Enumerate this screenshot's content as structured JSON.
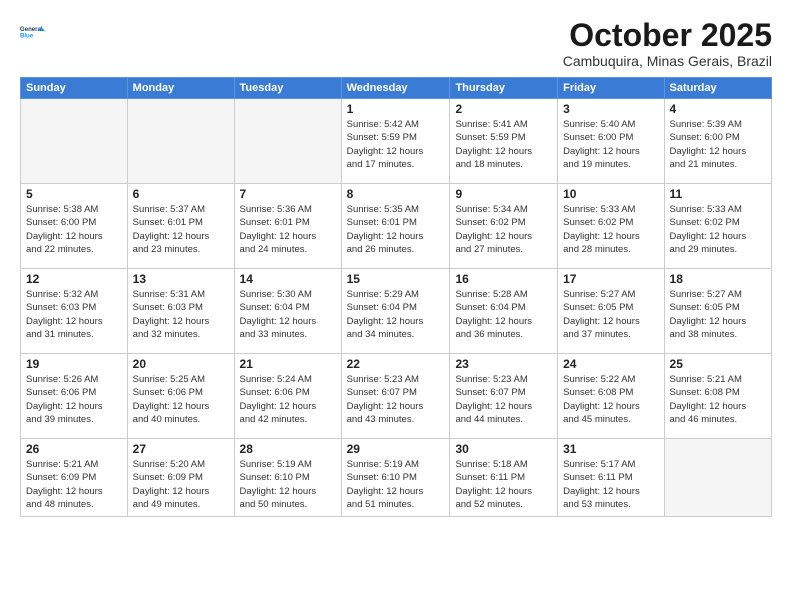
{
  "logo": {
    "line1": "General",
    "line2": "Blue"
  },
  "title": "October 2025",
  "location": "Cambuquira, Minas Gerais, Brazil",
  "days_header": [
    "Sunday",
    "Monday",
    "Tuesday",
    "Wednesday",
    "Thursday",
    "Friday",
    "Saturday"
  ],
  "weeks": [
    [
      {
        "day": "",
        "info": ""
      },
      {
        "day": "",
        "info": ""
      },
      {
        "day": "",
        "info": ""
      },
      {
        "day": "1",
        "info": "Sunrise: 5:42 AM\nSunset: 5:59 PM\nDaylight: 12 hours\nand 17 minutes."
      },
      {
        "day": "2",
        "info": "Sunrise: 5:41 AM\nSunset: 5:59 PM\nDaylight: 12 hours\nand 18 minutes."
      },
      {
        "day": "3",
        "info": "Sunrise: 5:40 AM\nSunset: 6:00 PM\nDaylight: 12 hours\nand 19 minutes."
      },
      {
        "day": "4",
        "info": "Sunrise: 5:39 AM\nSunset: 6:00 PM\nDaylight: 12 hours\nand 21 minutes."
      }
    ],
    [
      {
        "day": "5",
        "info": "Sunrise: 5:38 AM\nSunset: 6:00 PM\nDaylight: 12 hours\nand 22 minutes."
      },
      {
        "day": "6",
        "info": "Sunrise: 5:37 AM\nSunset: 6:01 PM\nDaylight: 12 hours\nand 23 minutes."
      },
      {
        "day": "7",
        "info": "Sunrise: 5:36 AM\nSunset: 6:01 PM\nDaylight: 12 hours\nand 24 minutes."
      },
      {
        "day": "8",
        "info": "Sunrise: 5:35 AM\nSunset: 6:01 PM\nDaylight: 12 hours\nand 26 minutes."
      },
      {
        "day": "9",
        "info": "Sunrise: 5:34 AM\nSunset: 6:02 PM\nDaylight: 12 hours\nand 27 minutes."
      },
      {
        "day": "10",
        "info": "Sunrise: 5:33 AM\nSunset: 6:02 PM\nDaylight: 12 hours\nand 28 minutes."
      },
      {
        "day": "11",
        "info": "Sunrise: 5:33 AM\nSunset: 6:02 PM\nDaylight: 12 hours\nand 29 minutes."
      }
    ],
    [
      {
        "day": "12",
        "info": "Sunrise: 5:32 AM\nSunset: 6:03 PM\nDaylight: 12 hours\nand 31 minutes."
      },
      {
        "day": "13",
        "info": "Sunrise: 5:31 AM\nSunset: 6:03 PM\nDaylight: 12 hours\nand 32 minutes."
      },
      {
        "day": "14",
        "info": "Sunrise: 5:30 AM\nSunset: 6:04 PM\nDaylight: 12 hours\nand 33 minutes."
      },
      {
        "day": "15",
        "info": "Sunrise: 5:29 AM\nSunset: 6:04 PM\nDaylight: 12 hours\nand 34 minutes."
      },
      {
        "day": "16",
        "info": "Sunrise: 5:28 AM\nSunset: 6:04 PM\nDaylight: 12 hours\nand 36 minutes."
      },
      {
        "day": "17",
        "info": "Sunrise: 5:27 AM\nSunset: 6:05 PM\nDaylight: 12 hours\nand 37 minutes."
      },
      {
        "day": "18",
        "info": "Sunrise: 5:27 AM\nSunset: 6:05 PM\nDaylight: 12 hours\nand 38 minutes."
      }
    ],
    [
      {
        "day": "19",
        "info": "Sunrise: 5:26 AM\nSunset: 6:06 PM\nDaylight: 12 hours\nand 39 minutes."
      },
      {
        "day": "20",
        "info": "Sunrise: 5:25 AM\nSunset: 6:06 PM\nDaylight: 12 hours\nand 40 minutes."
      },
      {
        "day": "21",
        "info": "Sunrise: 5:24 AM\nSunset: 6:06 PM\nDaylight: 12 hours\nand 42 minutes."
      },
      {
        "day": "22",
        "info": "Sunrise: 5:23 AM\nSunset: 6:07 PM\nDaylight: 12 hours\nand 43 minutes."
      },
      {
        "day": "23",
        "info": "Sunrise: 5:23 AM\nSunset: 6:07 PM\nDaylight: 12 hours\nand 44 minutes."
      },
      {
        "day": "24",
        "info": "Sunrise: 5:22 AM\nSunset: 6:08 PM\nDaylight: 12 hours\nand 45 minutes."
      },
      {
        "day": "25",
        "info": "Sunrise: 5:21 AM\nSunset: 6:08 PM\nDaylight: 12 hours\nand 46 minutes."
      }
    ],
    [
      {
        "day": "26",
        "info": "Sunrise: 5:21 AM\nSunset: 6:09 PM\nDaylight: 12 hours\nand 48 minutes."
      },
      {
        "day": "27",
        "info": "Sunrise: 5:20 AM\nSunset: 6:09 PM\nDaylight: 12 hours\nand 49 minutes."
      },
      {
        "day": "28",
        "info": "Sunrise: 5:19 AM\nSunset: 6:10 PM\nDaylight: 12 hours\nand 50 minutes."
      },
      {
        "day": "29",
        "info": "Sunrise: 5:19 AM\nSunset: 6:10 PM\nDaylight: 12 hours\nand 51 minutes."
      },
      {
        "day": "30",
        "info": "Sunrise: 5:18 AM\nSunset: 6:11 PM\nDaylight: 12 hours\nand 52 minutes."
      },
      {
        "day": "31",
        "info": "Sunrise: 5:17 AM\nSunset: 6:11 PM\nDaylight: 12 hours\nand 53 minutes."
      },
      {
        "day": "",
        "info": ""
      }
    ]
  ]
}
